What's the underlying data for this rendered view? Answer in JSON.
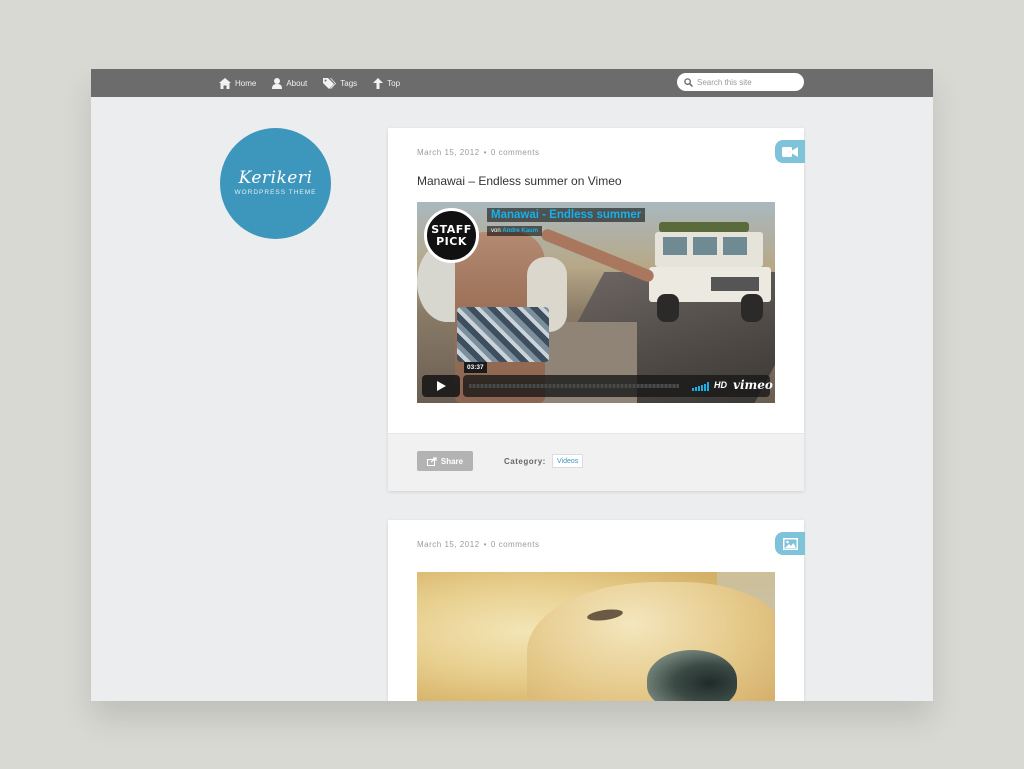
{
  "site": {
    "logo_title": "Kerikeri",
    "logo_subtitle": "WORDPRESS THEME"
  },
  "nav": {
    "items": [
      {
        "label": "Home",
        "icon": "home-icon"
      },
      {
        "label": "About",
        "icon": "user-icon"
      },
      {
        "label": "Tags",
        "icon": "tags-icon"
      },
      {
        "label": "Top",
        "icon": "arrow-up-icon"
      }
    ]
  },
  "search": {
    "placeholder": "Search this site",
    "value": ""
  },
  "posts": [
    {
      "date": "March 15, 2012",
      "separator": "•",
      "comments": "0 comments",
      "type_icon": "video-camera-icon",
      "title": "Manawai – Endless summer on Vimeo",
      "video": {
        "badge_line1": "STAFF",
        "badge_line2": "PICK",
        "title": "Manawai - Endless summer",
        "by_prefix": "von",
        "author": "Andre Kaum",
        "time": "03:37",
        "hd": "HD",
        "brand": "vimeo"
      },
      "share_label": "Share",
      "category_label": "Category:",
      "category": "Videos"
    },
    {
      "date": "March 15, 2012",
      "separator": "•",
      "comments": "0 comments",
      "type_icon": "image-icon"
    }
  ],
  "colors": {
    "accent": "#3d96bc",
    "badge": "#7ec3d9",
    "topbar": "#6c6c6c",
    "vimeo_blue": "#18b0e8"
  }
}
